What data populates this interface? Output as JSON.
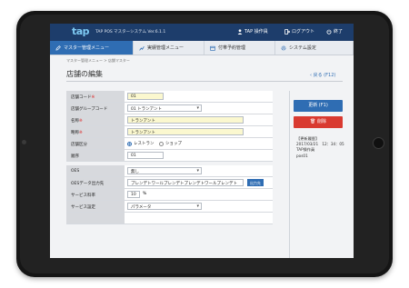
{
  "header": {
    "logo": "tap",
    "app_title": "TAP POS マスターシステム Ver.6.1.1",
    "user": "TAP 操作員",
    "logout": "ログアウト",
    "exit": "終了"
  },
  "menu": {
    "tabs": [
      {
        "label": "マスター管理メニュー",
        "icon": "pencil-icon"
      },
      {
        "label": "実績管理メニュー",
        "icon": "chart-icon"
      },
      {
        "label": "付帯予約管理",
        "icon": "calendar-icon"
      },
      {
        "label": "システム設定",
        "icon": "gear-icon"
      }
    ],
    "active": 0
  },
  "breadcrumb": "マスター管理メニュー > 店舗マスター",
  "page": {
    "title": "店舗の編集",
    "back": "戻る (F12)"
  },
  "form": {
    "store_code": {
      "label": "店舗コード",
      "value": "01"
    },
    "store_group_code": {
      "label": "店舗グループコード",
      "value": "01 トランアント"
    },
    "name": {
      "label": "名称",
      "value": "トランアント"
    },
    "short_name": {
      "label": "略称",
      "value": "トランアント"
    },
    "category": {
      "label": "店舗区分",
      "options": [
        "レストラン",
        "ショップ"
      ],
      "selected": 0
    },
    "order": {
      "label": "順序",
      "value": "01"
    },
    "oes": {
      "label": "OES",
      "value": "無し"
    },
    "oes_output": {
      "label": "OESデータ出力先",
      "value": "プレンデトワールプレンデトプレンデトワールプレンデト",
      "button": "出力先"
    },
    "service_rate": {
      "label": "サービス料率",
      "value": "10",
      "unit": "%"
    },
    "service_setting": {
      "label": "サービス設定",
      "value": "パラメータ"
    }
  },
  "actions": {
    "update": "更新 (F1)",
    "delete": "削除"
  },
  "update_info": {
    "heading": "【更新履歴】",
    "datetime": "2017/03/21　12：34：05",
    "user": "TAP操作員",
    "terminal": "pos01"
  },
  "colors": {
    "header": "#1d3d6b",
    "accent": "#2f6db3",
    "danger": "#d93a30",
    "required_field": "#fbf8cf"
  }
}
